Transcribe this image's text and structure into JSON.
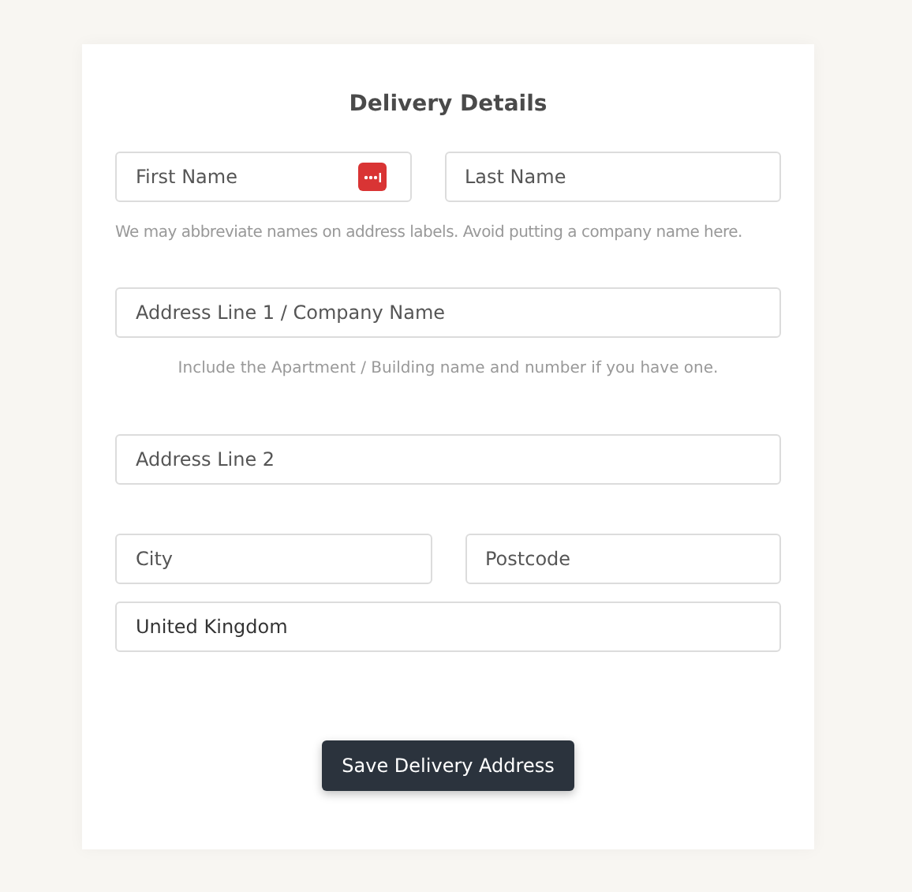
{
  "form": {
    "title": "Delivery Details",
    "first_name": {
      "placeholder": "First Name"
    },
    "last_name": {
      "placeholder": "Last Name"
    },
    "name_hint": "We may abbreviate names on address labels. Avoid putting a company name here.",
    "address_line_1": {
      "placeholder": "Address Line 1 / Company Name"
    },
    "address_hint": "Include the Apartment / Building name and number if you have one.",
    "address_line_2": {
      "placeholder": "Address Line 2"
    },
    "city": {
      "placeholder": "City"
    },
    "postcode": {
      "placeholder": "Postcode"
    },
    "country": {
      "value": "United Kingdom"
    },
    "save_button": "Save Delivery Address"
  }
}
